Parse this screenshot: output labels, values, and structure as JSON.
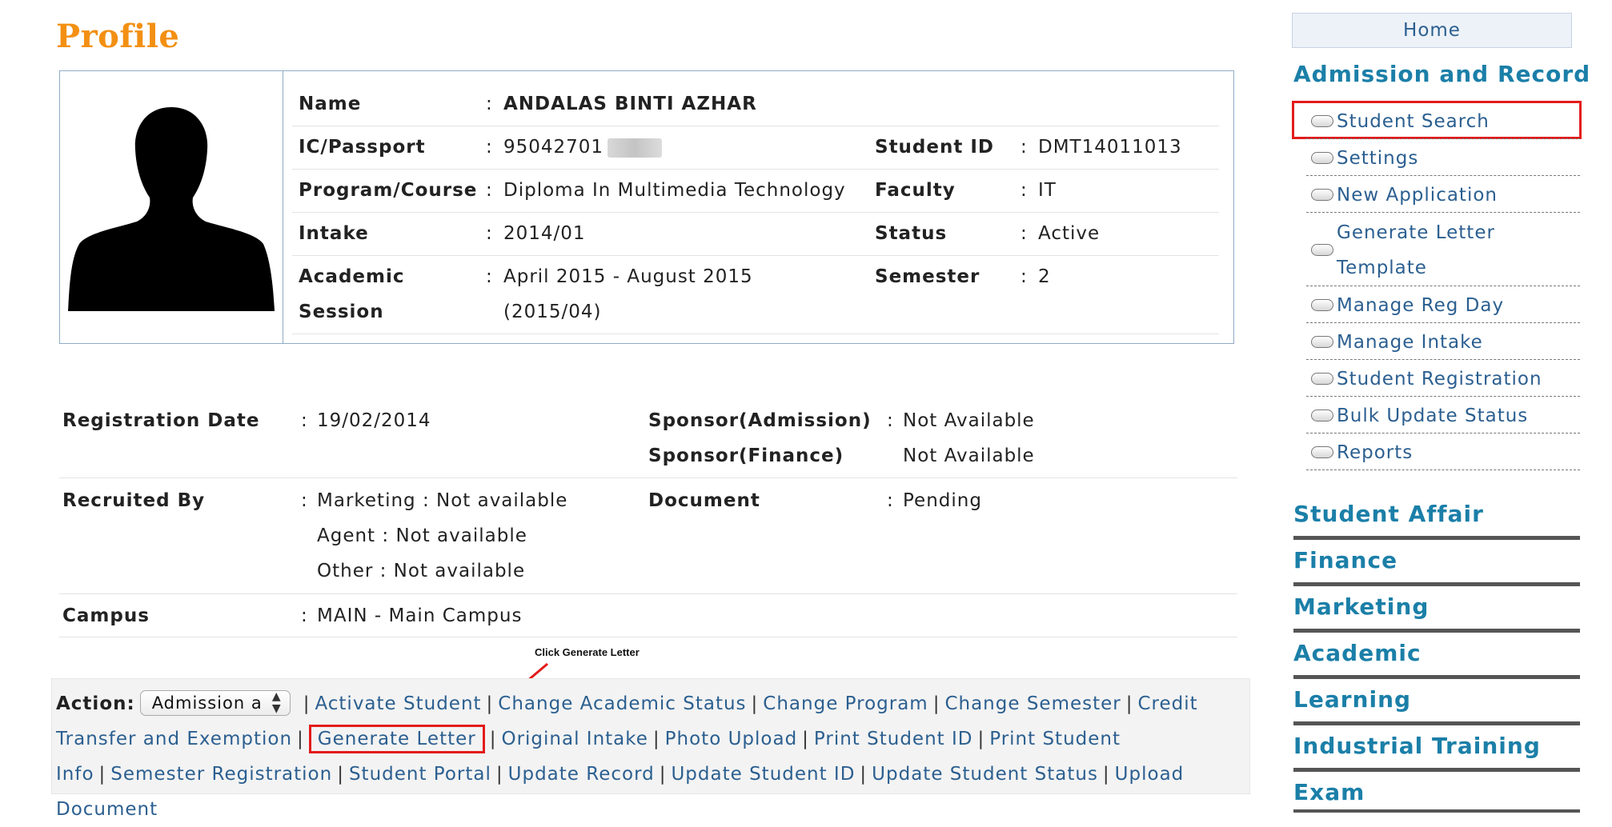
{
  "page_title": "Profile",
  "profile": {
    "name_label": "Name",
    "name_value": "ANDALAS BINTI AZHAR",
    "ic_label": "IC/Passport",
    "ic_value": "95042701",
    "student_id_label": "Student ID",
    "student_id_value": "DMT14011013",
    "program_label": "Program/Course",
    "program_value": "Diploma In Multimedia Technology",
    "faculty_label": "Faculty",
    "faculty_value": "IT",
    "intake_label": "Intake",
    "intake_value": "2014/01",
    "status_label": "Status",
    "status_value": "Active",
    "academic_label_1": "Academic",
    "academic_label_2": "Session",
    "academic_value_1": "April 2015 - August 2015",
    "academic_value_2": "(2015/04)",
    "semester_label": "Semester",
    "semester_value": "2"
  },
  "details": {
    "reg_date_label": "Registration Date",
    "reg_date_value": "19/02/2014",
    "sponsor_adm_label": "Sponsor(Admission)",
    "sponsor_adm_value": "Not Available",
    "sponsor_fin_label": "Sponsor(Finance)",
    "sponsor_fin_value": "Not Available",
    "recruited_label": "Recruited By",
    "recruited_marketing": "Marketing : Not available",
    "recruited_agent": "Agent : Not available",
    "recruited_other": "Other : Not available",
    "document_label": "Document",
    "document_value": "Pending",
    "campus_label": "Campus",
    "campus_value": "MAIN - Main Campus"
  },
  "action": {
    "label": "Action:",
    "select_value": "Admission a",
    "links": [
      "Activate Student",
      "Change Academic Status",
      "Change Program",
      "Change Semester",
      "Credit Transfer and Exemption",
      "Generate Letter",
      "Original Intake",
      "Photo Upload",
      "Print Student ID",
      "Print Student Info",
      "Semester Registration",
      "Student Portal",
      "Update Record",
      "Update Student ID",
      "Update Student Status",
      "Upload Document"
    ],
    "annotation": "Click Generate Letter"
  },
  "sidebar": {
    "home": "Home",
    "admission_title": "Admission and Record",
    "admission_items": [
      "Student Search",
      "Settings",
      "New Application",
      "Generate Letter",
      "Template",
      "Manage Reg Day",
      "Manage Intake",
      "Student Registration",
      "Bulk Update Status",
      "Reports"
    ],
    "sections": [
      "Student Affair",
      "Finance",
      "Marketing",
      "Academic",
      "Learning",
      "Industrial Training",
      "Exam"
    ]
  },
  "colors": {
    "title": "#f39013",
    "link": "#2b5f90",
    "section": "#1b7fa8",
    "highlight": "#e31b1b"
  }
}
